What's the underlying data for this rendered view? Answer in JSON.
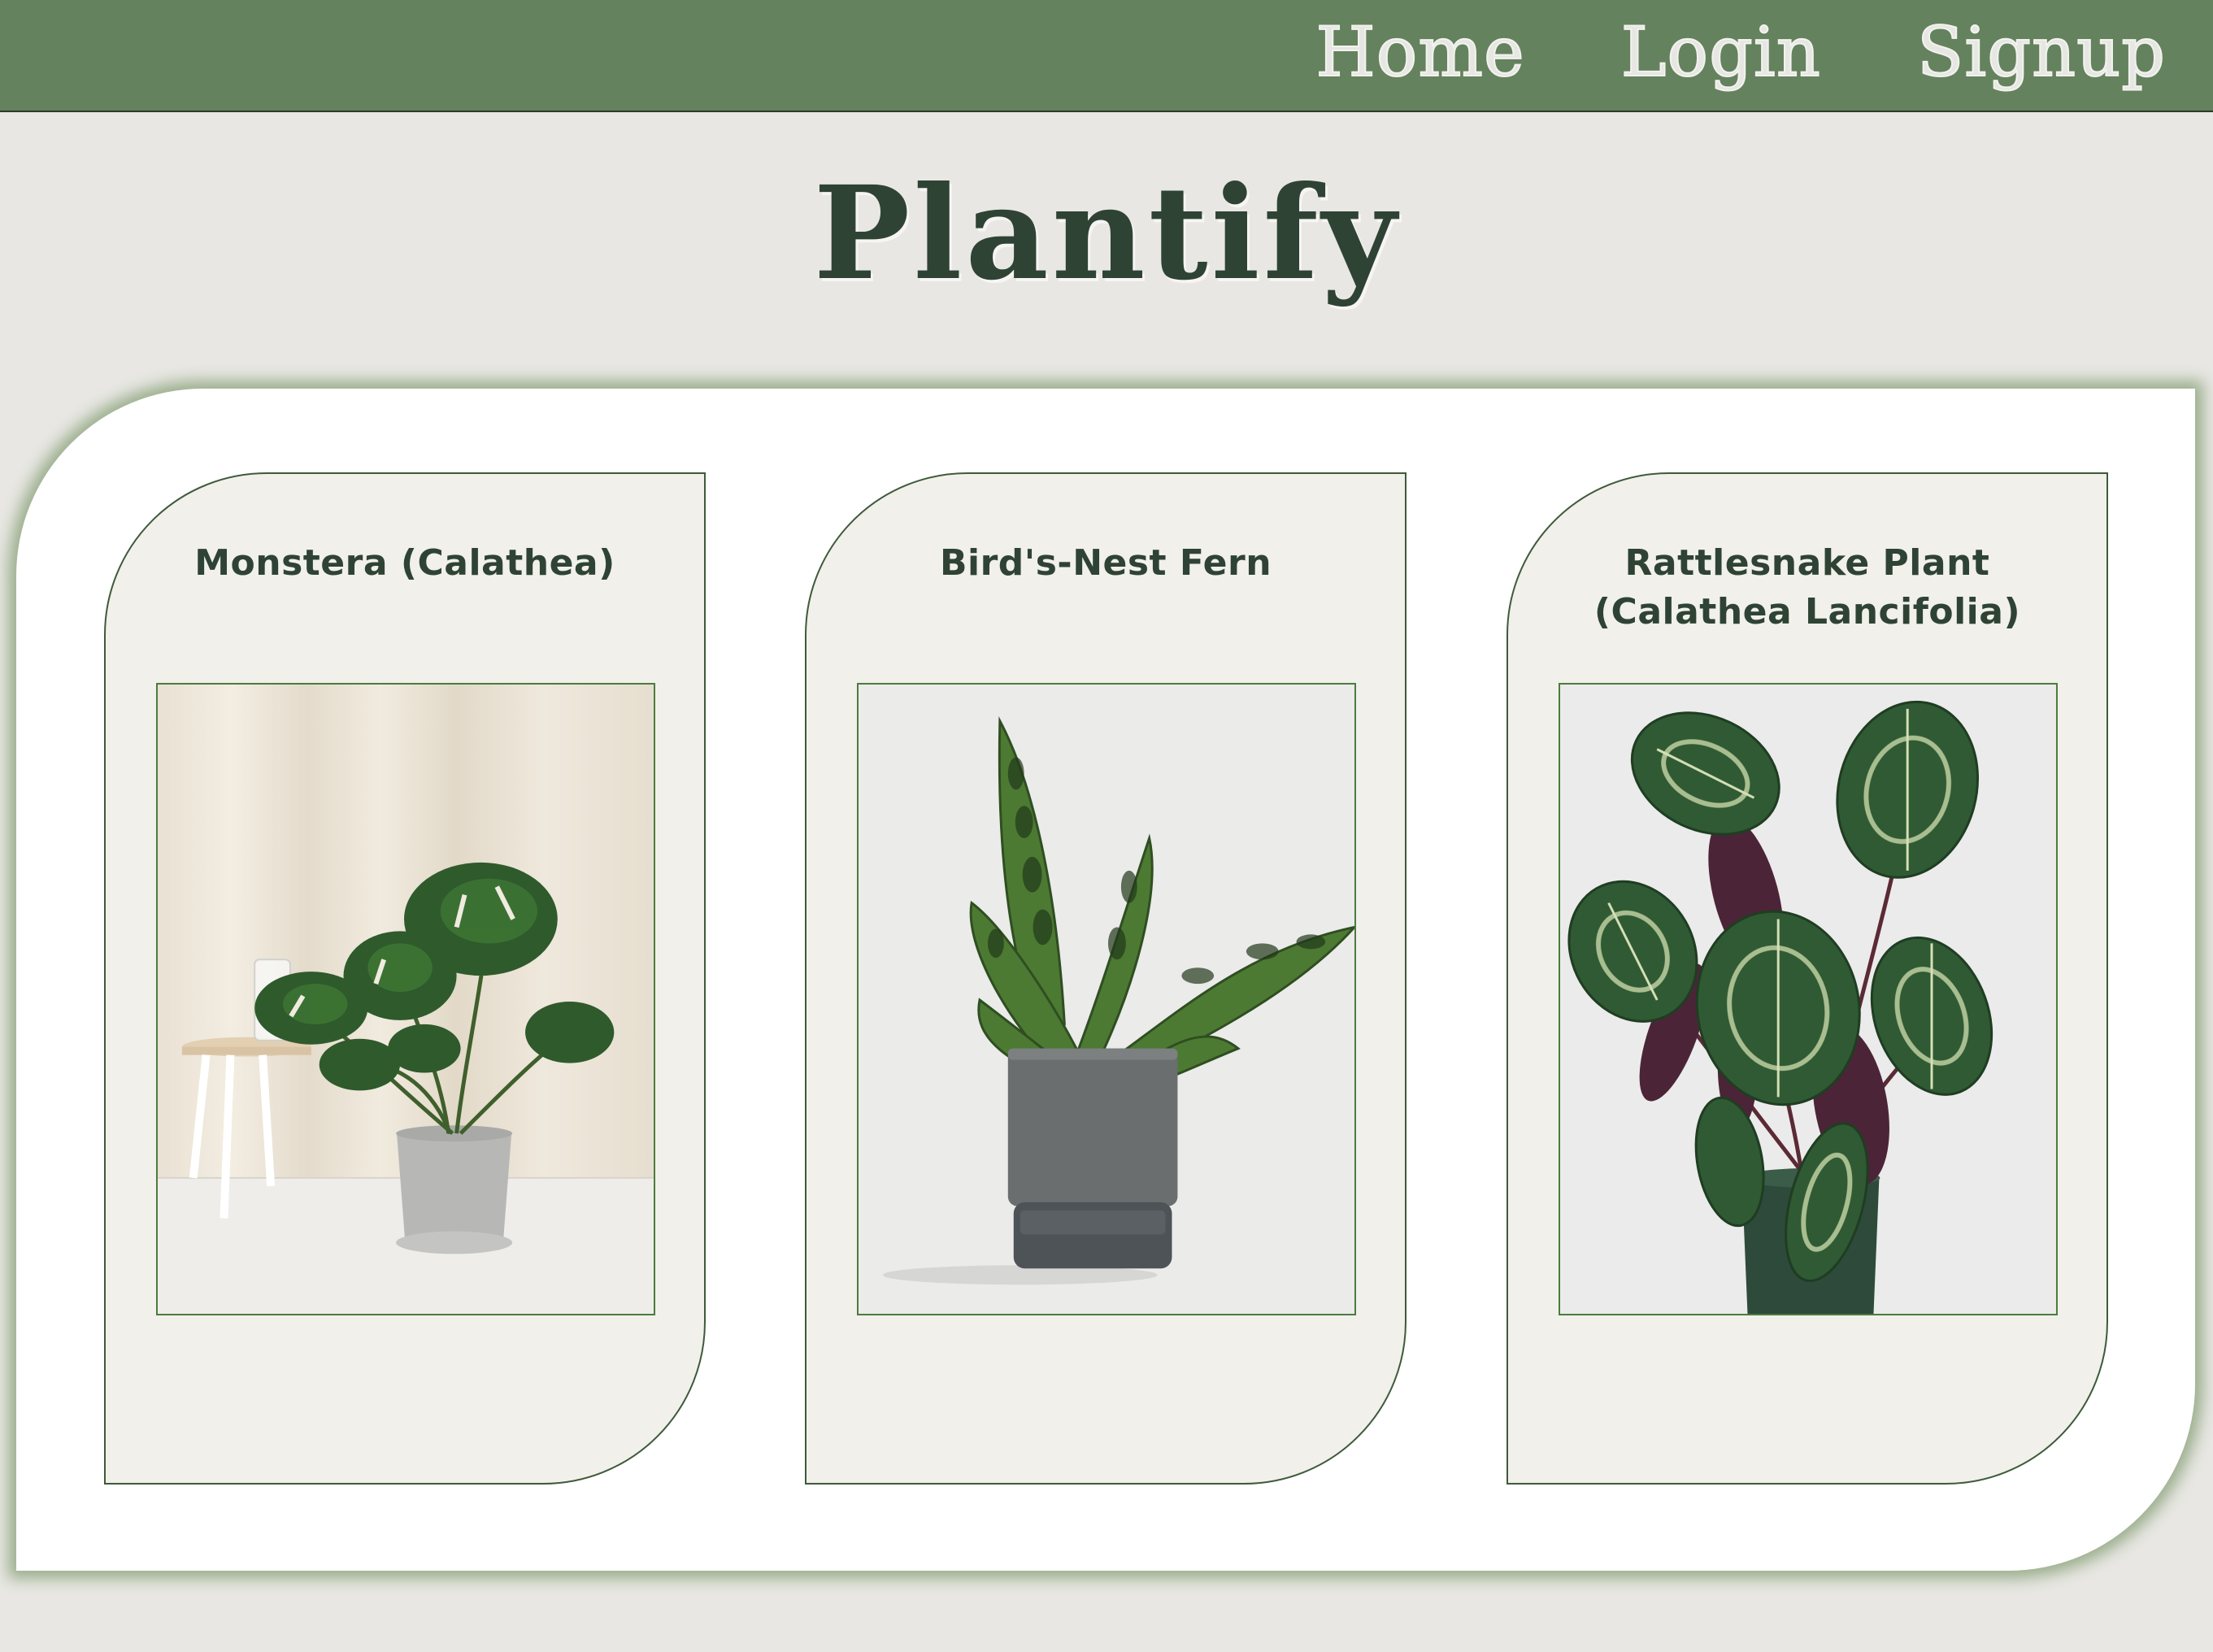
{
  "nav": {
    "links": [
      {
        "label": "Home"
      },
      {
        "label": "Login"
      },
      {
        "label": "Signup"
      }
    ]
  },
  "brand": {
    "title": "Plantify"
  },
  "plants": [
    {
      "name": "Monstera (Calathea)",
      "image_icon": "monstera-photo"
    },
    {
      "name": "Bird's-Nest Fern",
      "image_icon": "birds-nest-fern-photo"
    },
    {
      "name": "Rattlesnake Plant (Calathea Lancifolia)",
      "image_icon": "rattlesnake-plant-photo"
    }
  ],
  "colors": {
    "navbar": "#64825d",
    "page_background": "#e8e7e3",
    "panel": "#ffffff",
    "card": "#f1f0eb",
    "accent_dark": "#2f4335",
    "image_border": "#4c7b3e"
  }
}
